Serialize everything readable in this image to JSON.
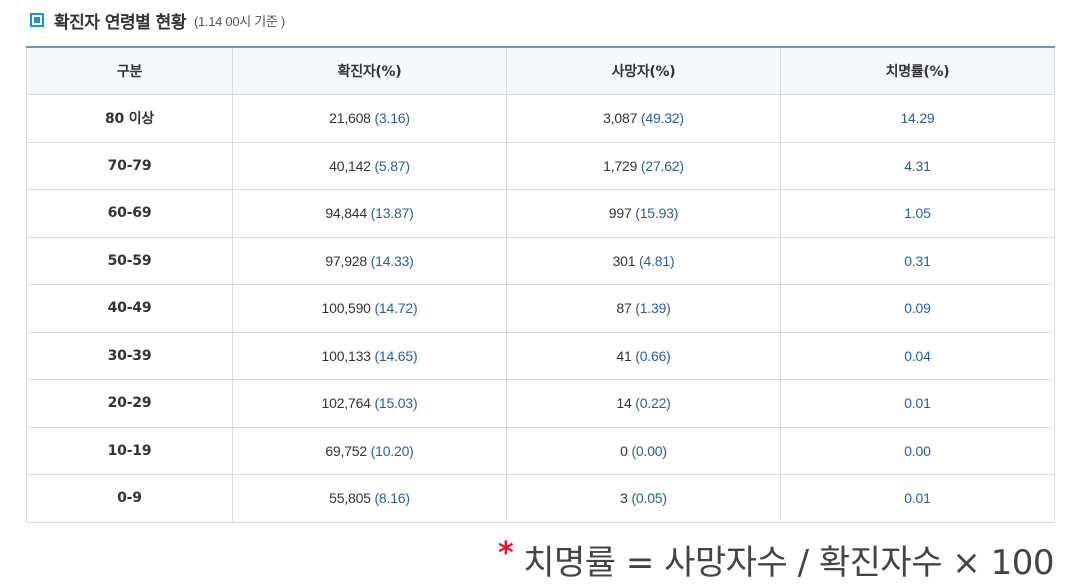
{
  "header": {
    "title": "확진자 연령별 현황",
    "subtitle": "(1.14 00시 기준 )"
  },
  "table": {
    "columns": [
      "구분",
      "확진자(%)",
      "사망자(%)",
      "치명률(%)"
    ],
    "rows": [
      {
        "category": "80 이상",
        "confirmed": "21,608",
        "confirmed_pct": "(3.16)",
        "deaths": "3,087",
        "deaths_pct": "(49.32)",
        "fatality": "14.29"
      },
      {
        "category": "70-79",
        "confirmed": "40,142",
        "confirmed_pct": "(5.87)",
        "deaths": "1,729",
        "deaths_pct": "(27.62)",
        "fatality": "4.31"
      },
      {
        "category": "60-69",
        "confirmed": "94,844",
        "confirmed_pct": "(13.87)",
        "deaths": "997",
        "deaths_pct": "(15.93)",
        "fatality": "1.05"
      },
      {
        "category": "50-59",
        "confirmed": "97,928",
        "confirmed_pct": "(14.33)",
        "deaths": "301",
        "deaths_pct": "(4.81)",
        "fatality": "0.31"
      },
      {
        "category": "40-49",
        "confirmed": "100,590",
        "confirmed_pct": "(14.72)",
        "deaths": "87",
        "deaths_pct": "(1.39)",
        "fatality": "0.09"
      },
      {
        "category": "30-39",
        "confirmed": "100,133",
        "confirmed_pct": "(14.65)",
        "deaths": "41",
        "deaths_pct": "(0.66)",
        "fatality": "0.04"
      },
      {
        "category": "20-29",
        "confirmed": "102,764",
        "confirmed_pct": "(15.03)",
        "deaths": "14",
        "deaths_pct": "(0.22)",
        "fatality": "0.01"
      },
      {
        "category": "10-19",
        "confirmed": "69,752",
        "confirmed_pct": "(10.20)",
        "deaths": "0",
        "deaths_pct": "(0.00)",
        "fatality": "0.00"
      },
      {
        "category": "0-9",
        "confirmed": "55,805",
        "confirmed_pct": "(8.16)",
        "deaths": "3",
        "deaths_pct": "(0.05)",
        "fatality": "0.01"
      }
    ]
  },
  "footnote": {
    "marker": "*",
    "formula": "치명률 = 사망자수 / 확진자수 × 100"
  },
  "colors": {
    "accent": "#1a93d6",
    "header_border": "#6d93c0",
    "percent_text": "#2a5d9c",
    "asterisk": "#d7192a"
  }
}
